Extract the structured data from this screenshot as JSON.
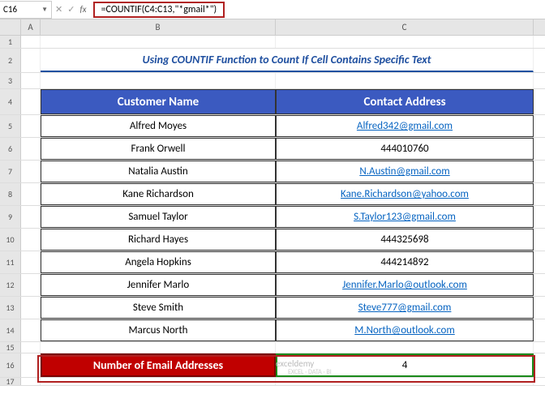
{
  "nameBox": "C16",
  "formula": "=COUNTIF(C4:C13,\"*gmail*\")",
  "columns": {
    "A": "A",
    "B": "B",
    "C": "C"
  },
  "rows": [
    "1",
    "2",
    "3",
    "4",
    "5",
    "6",
    "7",
    "8",
    "9",
    "10",
    "11",
    "12",
    "13",
    "14",
    "15",
    "16",
    "17"
  ],
  "title": "Using COUNTIF Function to Count If Cell Contains Specific Text",
  "headers": {
    "name": "Customer Name",
    "contact": "Contact Address"
  },
  "data": [
    {
      "name": "Alfred Moyes",
      "contact": "Alfred342@gmail.com",
      "isLink": true
    },
    {
      "name": "Frank Orwell",
      "contact": "444010760",
      "isLink": false
    },
    {
      "name": "Natalia Austin",
      "contact": "N.Austin@gmail.com",
      "isLink": true
    },
    {
      "name": "Kane Richardson",
      "contact": "Kane.Richardson@yahoo.com",
      "isLink": true
    },
    {
      "name": "Samuel Taylor",
      "contact": "S.Taylor123@gmail.com",
      "isLink": true
    },
    {
      "name": "Richard Hayes",
      "contact": "444325698",
      "isLink": false
    },
    {
      "name": "Angela Hopkins",
      "contact": "444214892",
      "isLink": false
    },
    {
      "name": "Jennifer Marlo",
      "contact": "Jennifer.Marlo@outlook.com",
      "isLink": true
    },
    {
      "name": "Steve Smith",
      "contact": "Steve777@gmail.com",
      "isLink": true
    },
    {
      "name": "Marcus North",
      "contact": "M.North@outlook.com",
      "isLink": true
    }
  ],
  "result": {
    "label": "Number of Email Addresses",
    "value": "4"
  },
  "watermark": {
    "main": "exceldemy",
    "sub": "EXCEL · DATA · BI"
  }
}
